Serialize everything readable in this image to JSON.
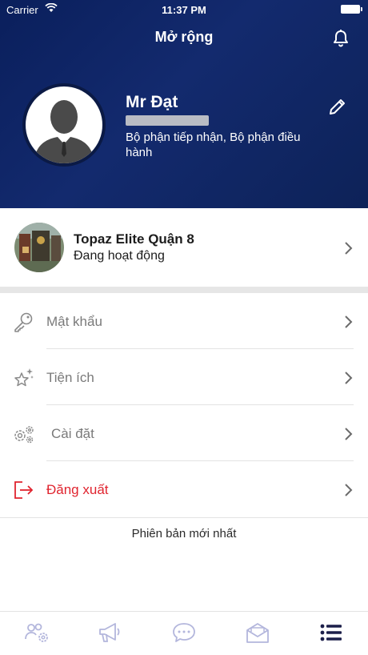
{
  "status_bar": {
    "carrier": "Carrier",
    "time": "11:37 PM"
  },
  "header": {
    "title": "Mở rộng"
  },
  "profile": {
    "name": "Mr Đạt",
    "department": "Bộ phận tiếp nhận, Bộ phận điều hành"
  },
  "property": {
    "name": "Topaz Elite Quận 8",
    "status": "Đang hoạt động"
  },
  "menu": [
    {
      "label": "Mật khẩu",
      "icon": "key-icon"
    },
    {
      "label": "Tiện ích",
      "icon": "sparkle-star-icon"
    },
    {
      "label": "Cài đặt",
      "icon": "gears-icon"
    },
    {
      "label": "Đăng xuất",
      "icon": "logout-icon"
    }
  ],
  "version_text": "Phiên bản mới nhất",
  "tabbar": [
    {
      "icon": "users-settings-icon",
      "active": false
    },
    {
      "icon": "megaphone-icon",
      "active": false
    },
    {
      "icon": "chat-icon",
      "active": false
    },
    {
      "icon": "mail-icon",
      "active": false
    },
    {
      "icon": "list-icon",
      "active": true
    }
  ],
  "colors": {
    "header_dark": "#0a1f5c",
    "danger": "#e0242f",
    "tab_inactive": "#b3b6dc",
    "tab_active": "#1c1f4a"
  }
}
